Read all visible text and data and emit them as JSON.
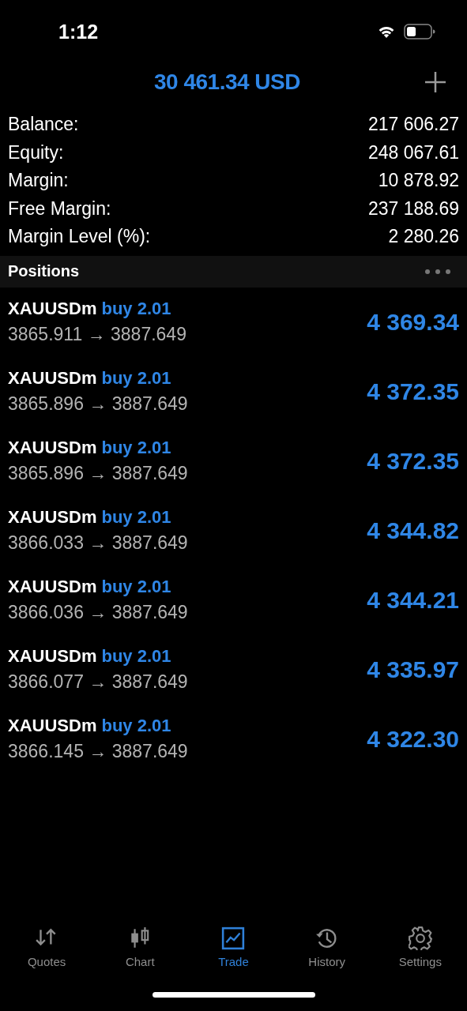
{
  "status_bar": {
    "time": "1:12"
  },
  "header": {
    "title": "30 461.34 USD"
  },
  "summary": [
    {
      "label": "Balance:",
      "value": "217 606.27"
    },
    {
      "label": "Equity:",
      "value": "248 067.61"
    },
    {
      "label": "Margin:",
      "value": "10 878.92"
    },
    {
      "label": "Free Margin:",
      "value": "237 188.69"
    },
    {
      "label": "Margin Level (%):",
      "value": "2 280.26"
    }
  ],
  "positions_header": {
    "title": "Positions"
  },
  "positions": [
    {
      "symbol": "XAUUSDm",
      "order": "buy 2.01",
      "prices": "3865.911 → 3887.649",
      "profit": "4 369.34"
    },
    {
      "symbol": "XAUUSDm",
      "order": "buy 2.01",
      "prices": "3865.896 → 3887.649",
      "profit": "4 372.35"
    },
    {
      "symbol": "XAUUSDm",
      "order": "buy 2.01",
      "prices": "3865.896 → 3887.649",
      "profit": "4 372.35"
    },
    {
      "symbol": "XAUUSDm",
      "order": "buy 2.01",
      "prices": "3866.033 → 3887.649",
      "profit": "4 344.82"
    },
    {
      "symbol": "XAUUSDm",
      "order": "buy 2.01",
      "prices": "3866.036 → 3887.649",
      "profit": "4 344.21"
    },
    {
      "symbol": "XAUUSDm",
      "order": "buy 2.01",
      "prices": "3866.077 → 3887.649",
      "profit": "4 335.97"
    },
    {
      "symbol": "XAUUSDm",
      "order": "buy 2.01",
      "prices": "3866.145 → 3887.649",
      "profit": "4 322.30"
    }
  ],
  "tabs": [
    {
      "label": "Quotes",
      "selected": false
    },
    {
      "label": "Chart",
      "selected": false
    },
    {
      "label": "Trade",
      "selected": true
    },
    {
      "label": "History",
      "selected": false
    },
    {
      "label": "Settings",
      "selected": false
    }
  ]
}
